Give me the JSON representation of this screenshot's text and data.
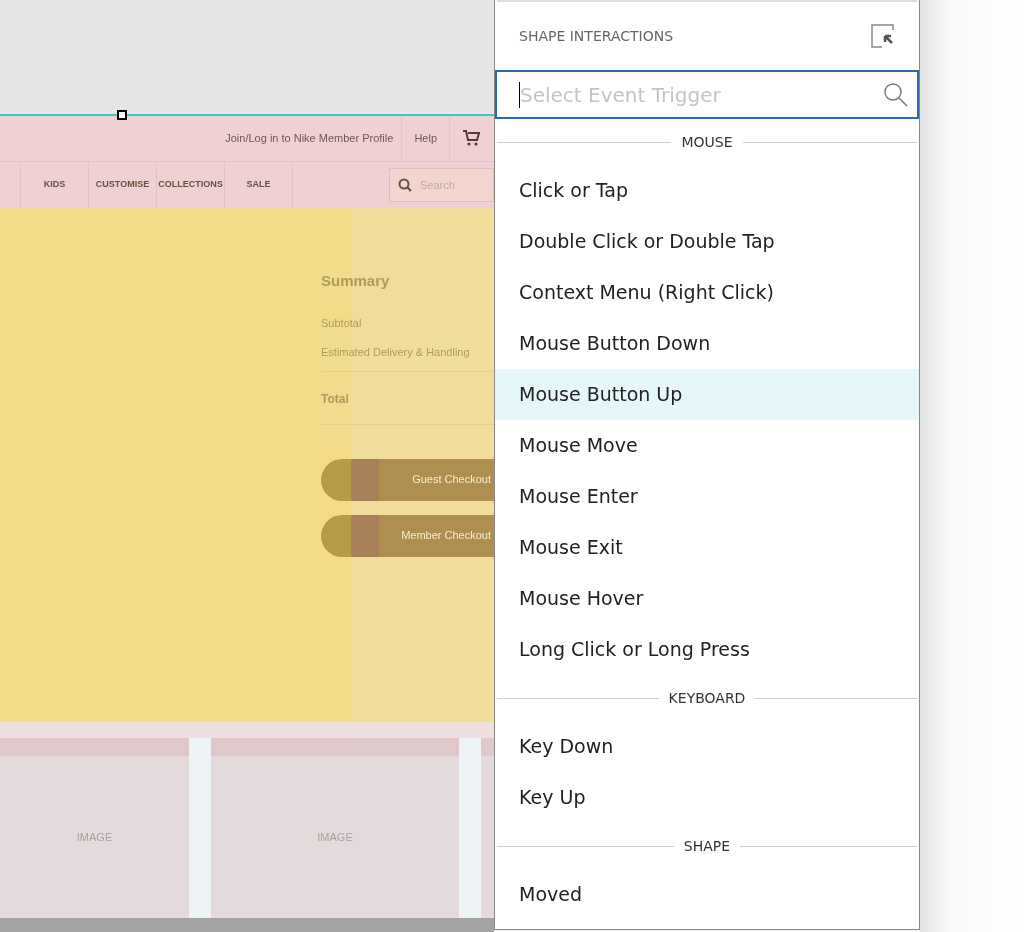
{
  "canvas": {
    "header_links": [
      "Join/Log in to Nike Member Profile",
      "Help"
    ],
    "nav": [
      "KIDS",
      "CUSTOMISE",
      "COLLECTIONS",
      "SALE"
    ],
    "search": {
      "placeholder": "Search"
    },
    "summary": {
      "title": "Summary",
      "lines": [
        "Subtotal",
        "Estimated Delivery & Handling"
      ],
      "total": "Total",
      "buttons": [
        "Guest Checkout",
        "Member Checkout"
      ]
    },
    "image_labels": [
      "IMAGE",
      "IMAGE"
    ]
  },
  "panel": {
    "title": "SHAPE INTERACTIONS",
    "search": {
      "placeholder": "Select Event Trigger"
    },
    "groups": [
      {
        "heading": "MOUSE",
        "items": [
          {
            "label": "Click or Tap",
            "selected": false
          },
          {
            "label": "Double Click or Double Tap",
            "selected": false
          },
          {
            "label": "Context Menu (Right Click)",
            "selected": false
          },
          {
            "label": "Mouse Button Down",
            "selected": false
          },
          {
            "label": "Mouse Button Up",
            "selected": true
          },
          {
            "label": "Mouse Move",
            "selected": false
          },
          {
            "label": "Mouse Enter",
            "selected": false
          },
          {
            "label": "Mouse Exit",
            "selected": false
          },
          {
            "label": "Mouse Hover",
            "selected": false
          },
          {
            "label": "Long Click or Long Press",
            "selected": false
          }
        ]
      },
      {
        "heading": "KEYBOARD",
        "items": [
          {
            "label": "Key Down",
            "selected": false
          },
          {
            "label": "Key Up",
            "selected": false
          }
        ]
      },
      {
        "heading": "SHAPE",
        "items": [
          {
            "label": "Moved",
            "selected": false
          }
        ]
      }
    ]
  }
}
